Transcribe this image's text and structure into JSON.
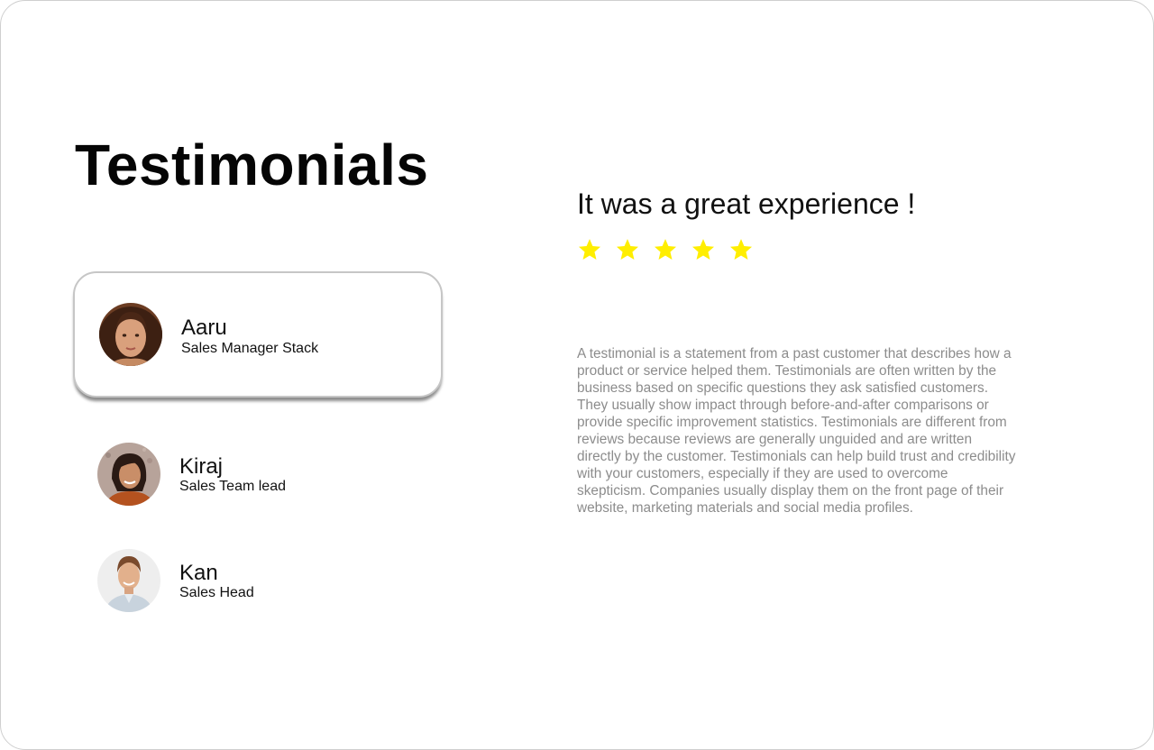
{
  "page": {
    "title": "Testimonials"
  },
  "people": [
    {
      "name": "Aaru",
      "role": "Sales Manager Stack",
      "selected": true,
      "avatar": "woman-portrait"
    },
    {
      "name": "Kiraj",
      "role": "Sales Team lead",
      "selected": false,
      "avatar": "smiling-woman-portrait"
    },
    {
      "name": "Kan",
      "role": "Sales Head",
      "selected": false,
      "avatar": "smiling-man-portrait"
    }
  ],
  "testimonial": {
    "headline": "It was a great experience !",
    "rating": 5,
    "star_icon": "star-icon",
    "star_color": "#ffee00",
    "body": "A testimonial is a statement from a past customer that describes how a product or service helped them. Testimonials are often written by the business based on specific questions they ask satisfied customers. They usually show impact through before-and-after comparisons or provide specific improvement statistics. Testimonials are different from reviews because reviews are generally unguided and are written directly by the customer. Testimonials can help build trust and credibility with your customers, especially if they are used to overcome skepticism. Companies usually display them on the front page of their website, marketing materials and social media profiles."
  }
}
